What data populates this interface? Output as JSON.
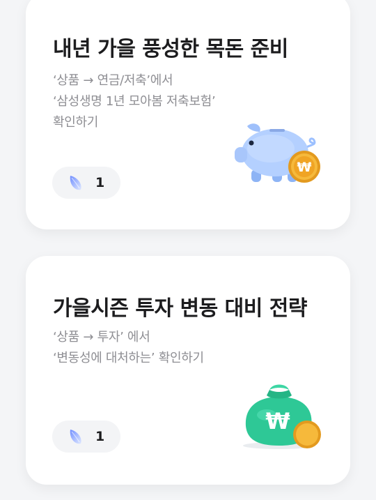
{
  "cards": [
    {
      "title": "내년 가을 풍성한 목돈 준비",
      "description_lines": [
        "‘상품 → 연금/저축’에서",
        "‘삼성생명 1년 모아봄 저축보험’",
        "확인하기"
      ],
      "count": "1",
      "badge_icon": "leaf-icon",
      "illustration": "piggy-bank-with-won-coin-icon"
    },
    {
      "title": "가을시즌 투자 변동 대비 전략",
      "description_lines": [
        "‘상품 → 투자’ 에서",
        "‘변동성에 대처하는’ 확인하기"
      ],
      "count": "1",
      "badge_icon": "leaf-icon",
      "illustration": "money-bag-with-won-coin-icon"
    }
  ],
  "colors": {
    "background": "#f4f5f7",
    "card": "#ffffff",
    "title": "#1c1c1e",
    "description": "#8e8e93",
    "piggy": "#a9c8ff",
    "money_bag": "#2ec896",
    "coin": "#f6b93b"
  }
}
